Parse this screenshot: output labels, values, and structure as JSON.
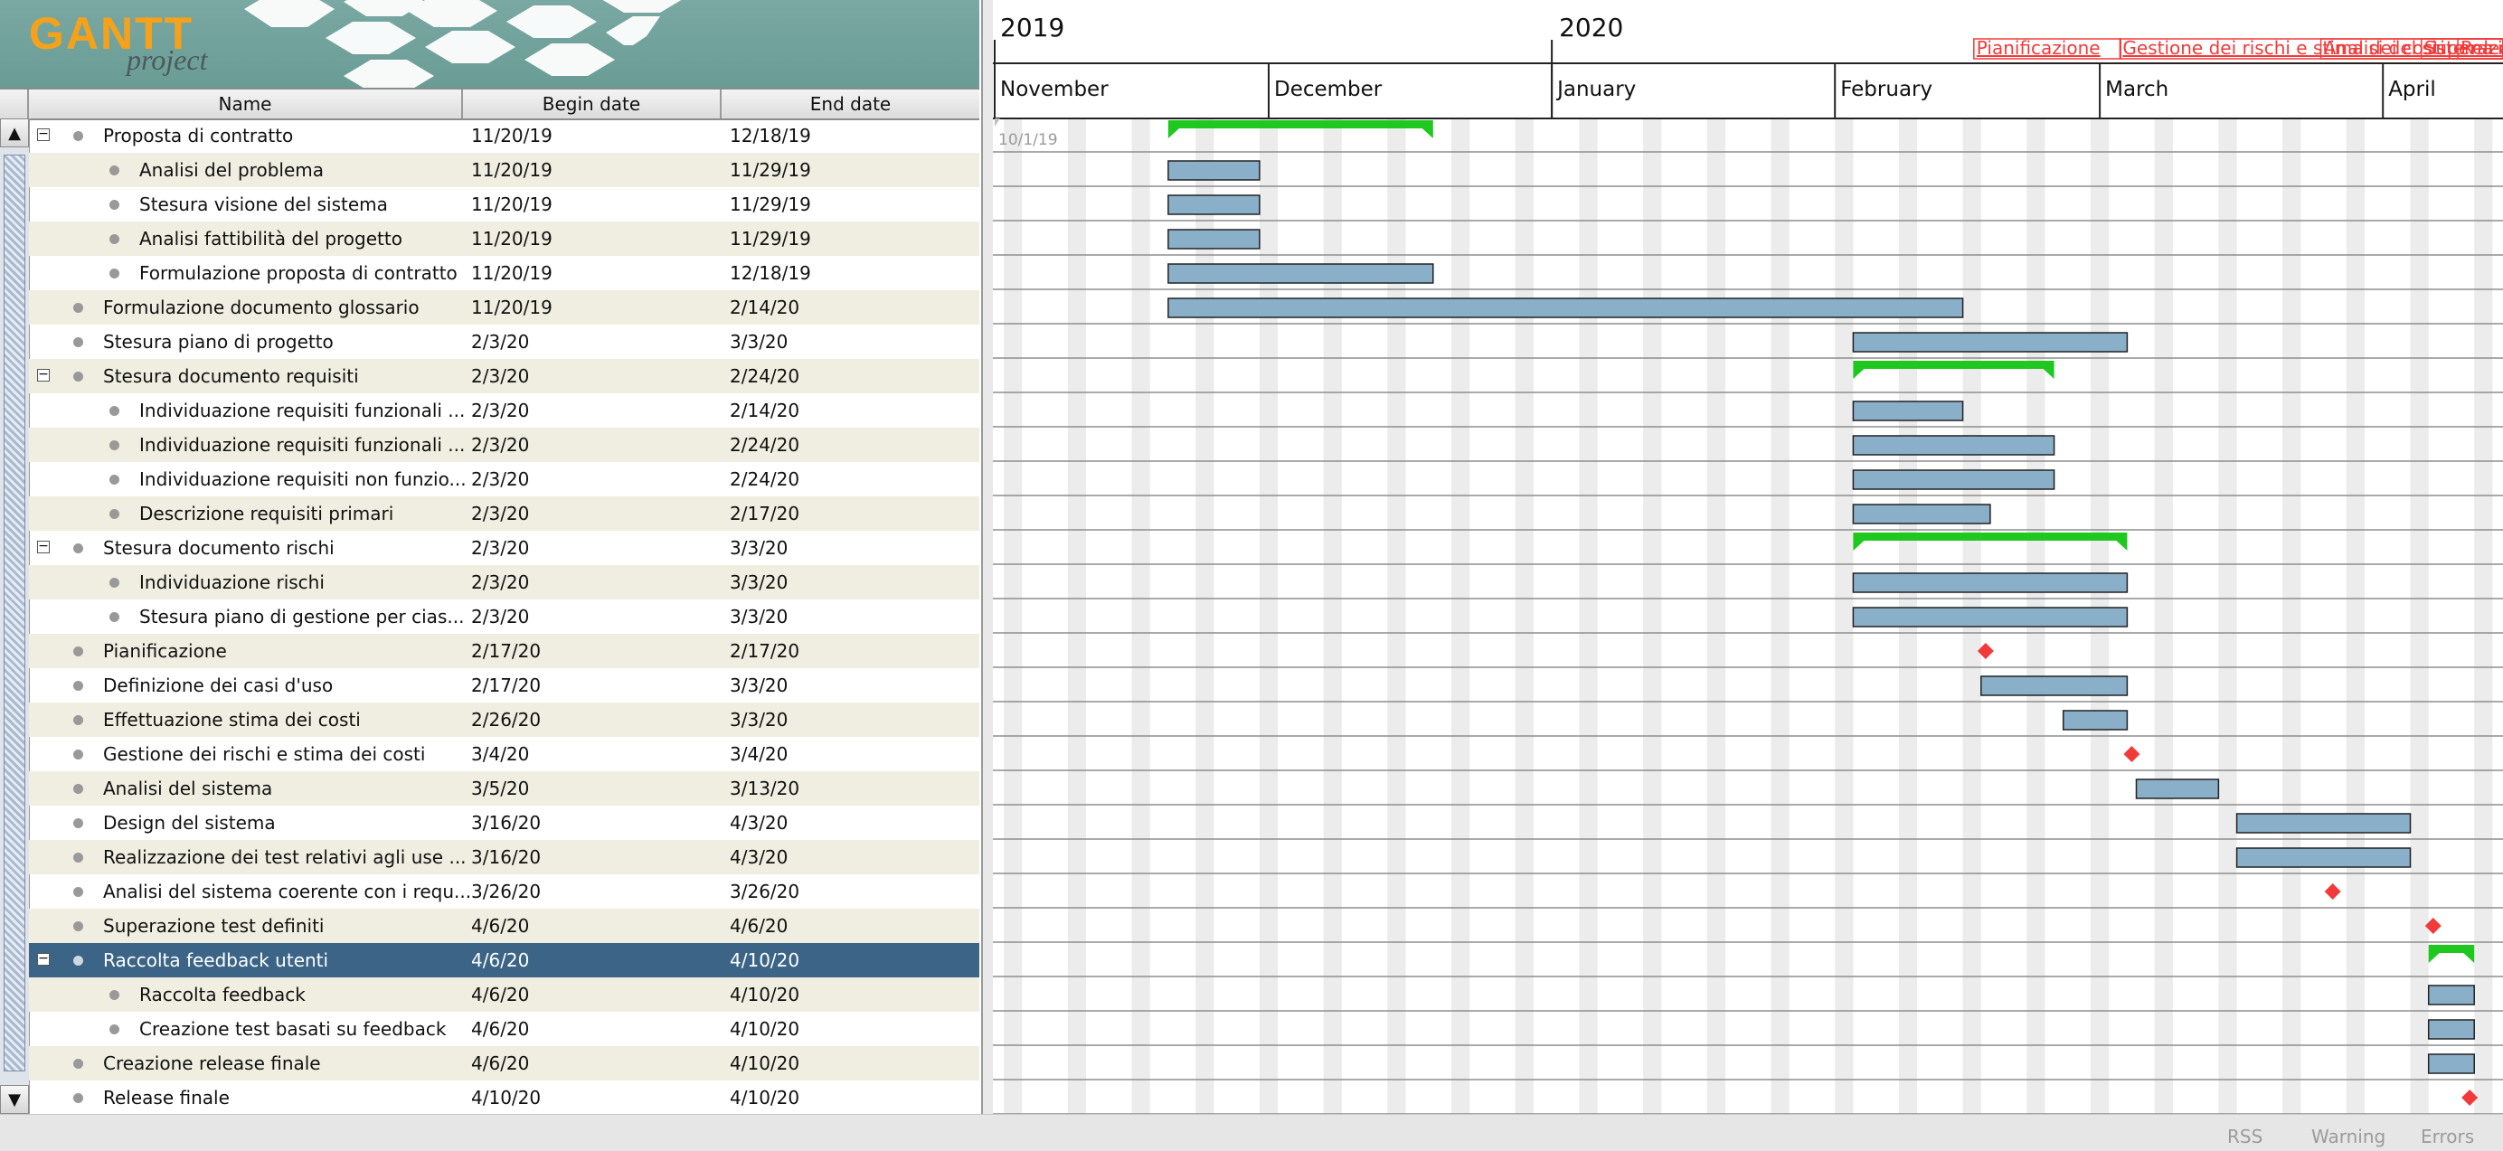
{
  "app": {
    "logo_text": "GANTT",
    "logo_sub": "project"
  },
  "table": {
    "columns": [
      "Name",
      "Begin date",
      "End date"
    ],
    "rows": [
      {
        "name": "Proposta di contratto",
        "begin": "11/20/19",
        "end": "12/18/19",
        "level": 0,
        "expander": "−",
        "selected": false
      },
      {
        "name": "Analisi del problema",
        "begin": "11/20/19",
        "end": "11/29/19",
        "level": 1,
        "expander": "",
        "selected": false
      },
      {
        "name": "Stesura visione del sistema",
        "begin": "11/20/19",
        "end": "11/29/19",
        "level": 1,
        "expander": "",
        "selected": false
      },
      {
        "name": "Analisi fattibilità del progetto",
        "begin": "11/20/19",
        "end": "11/29/19",
        "level": 1,
        "expander": "",
        "selected": false
      },
      {
        "name": "Formulazione proposta di contratto",
        "begin": "11/20/19",
        "end": "12/18/19",
        "level": 1,
        "expander": "",
        "selected": false
      },
      {
        "name": "Formulazione documento glossario",
        "begin": "11/20/19",
        "end": "2/14/20",
        "level": 0,
        "expander": "",
        "selected": false
      },
      {
        "name": "Stesura piano di progetto",
        "begin": "2/3/20",
        "end": "3/3/20",
        "level": 0,
        "expander": "",
        "selected": false
      },
      {
        "name": "Stesura documento requisiti",
        "begin": "2/3/20",
        "end": "2/24/20",
        "level": 0,
        "expander": "−",
        "selected": false
      },
      {
        "name": "Individuazione requisiti funzionali ...",
        "begin": "2/3/20",
        "end": "2/14/20",
        "level": 1,
        "expander": "",
        "selected": false
      },
      {
        "name": "Individuazione requisiti funzionali ...",
        "begin": "2/3/20",
        "end": "2/24/20",
        "level": 1,
        "expander": "",
        "selected": false
      },
      {
        "name": "Individuazione requisiti non funzio...",
        "begin": "2/3/20",
        "end": "2/24/20",
        "level": 1,
        "expander": "",
        "selected": false
      },
      {
        "name": "Descrizione requisiti primari",
        "begin": "2/3/20",
        "end": "2/17/20",
        "level": 1,
        "expander": "",
        "selected": false
      },
      {
        "name": "Stesura documento rischi",
        "begin": "2/3/20",
        "end": "3/3/20",
        "level": 0,
        "expander": "−",
        "selected": false
      },
      {
        "name": "Individuazione rischi",
        "begin": "2/3/20",
        "end": "3/3/20",
        "level": 1,
        "expander": "",
        "selected": false
      },
      {
        "name": "Stesura piano di gestione per cias...",
        "begin": "2/3/20",
        "end": "3/3/20",
        "level": 1,
        "expander": "",
        "selected": false
      },
      {
        "name": "Pianificazione",
        "begin": "2/17/20",
        "end": "2/17/20",
        "level": 0,
        "expander": "",
        "selected": false
      },
      {
        "name": "Definizione dei casi d'uso",
        "begin": "2/17/20",
        "end": "3/3/20",
        "level": 0,
        "expander": "",
        "selected": false
      },
      {
        "name": "Effettuazione stima dei costi",
        "begin": "2/26/20",
        "end": "3/3/20",
        "level": 0,
        "expander": "",
        "selected": false
      },
      {
        "name": "Gestione dei rischi e stima dei costi",
        "begin": "3/4/20",
        "end": "3/4/20",
        "level": 0,
        "expander": "",
        "selected": false
      },
      {
        "name": "Analisi del sistema",
        "begin": "3/5/20",
        "end": "3/13/20",
        "level": 0,
        "expander": "",
        "selected": false
      },
      {
        "name": "Design del sistema",
        "begin": "3/16/20",
        "end": "4/3/20",
        "level": 0,
        "expander": "",
        "selected": false
      },
      {
        "name": "Realizzazione dei test relativi agli use ...",
        "begin": "3/16/20",
        "end": "4/3/20",
        "level": 0,
        "expander": "",
        "selected": false
      },
      {
        "name": "Analisi del sistema coerente con i requ...",
        "begin": "3/26/20",
        "end": "3/26/20",
        "level": 0,
        "expander": "",
        "selected": false
      },
      {
        "name": "Superazione test definiti",
        "begin": "4/6/20",
        "end": "4/6/20",
        "level": 0,
        "expander": "",
        "selected": false
      },
      {
        "name": "Raccolta feedback utenti",
        "begin": "4/6/20",
        "end": "4/10/20",
        "level": 0,
        "expander": "−",
        "selected": true
      },
      {
        "name": "Raccolta feedback",
        "begin": "4/6/20",
        "end": "4/10/20",
        "level": 1,
        "expander": "",
        "selected": false
      },
      {
        "name": "Creazione test basati su feedback",
        "begin": "4/6/20",
        "end": "4/10/20",
        "level": 1,
        "expander": "",
        "selected": false
      },
      {
        "name": "Creazione release finale",
        "begin": "4/6/20",
        "end": "4/10/20",
        "level": 0,
        "expander": "",
        "selected": false
      },
      {
        "name": "Release finale",
        "begin": "4/10/20",
        "end": "4/10/20",
        "level": 0,
        "expander": "",
        "selected": false
      }
    ]
  },
  "timeline": {
    "years": [
      "2019",
      "2020"
    ],
    "months": [
      "November",
      "December",
      "January",
      "February",
      "March",
      "April"
    ],
    "view_start_label": "10/1/19",
    "milestone_labels": [
      "Pianificazione",
      "Gestione dei rischi e stima dei costi",
      "Analisi del sistema coerente con i requ...",
      "Superazione test definiti",
      "Release finale"
    ]
  },
  "tasks": [
    {
      "type": "summary",
      "start": "2019-11-20",
      "end": "2019-12-18"
    },
    {
      "type": "task",
      "start": "2019-11-20",
      "end": "2019-11-29"
    },
    {
      "type": "task",
      "start": "2019-11-20",
      "end": "2019-11-29"
    },
    {
      "type": "task",
      "start": "2019-11-20",
      "end": "2019-11-29"
    },
    {
      "type": "task",
      "start": "2019-11-20",
      "end": "2019-12-18"
    },
    {
      "type": "task",
      "start": "2019-11-20",
      "end": "2020-02-14"
    },
    {
      "type": "task",
      "start": "2020-02-03",
      "end": "2020-03-03"
    },
    {
      "type": "summary",
      "start": "2020-02-03",
      "end": "2020-02-24"
    },
    {
      "type": "task",
      "start": "2020-02-03",
      "end": "2020-02-14"
    },
    {
      "type": "task",
      "start": "2020-02-03",
      "end": "2020-02-24"
    },
    {
      "type": "task",
      "start": "2020-02-03",
      "end": "2020-02-24"
    },
    {
      "type": "task",
      "start": "2020-02-03",
      "end": "2020-02-17"
    },
    {
      "type": "summary",
      "start": "2020-02-03",
      "end": "2020-03-03"
    },
    {
      "type": "task",
      "start": "2020-02-03",
      "end": "2020-03-03"
    },
    {
      "type": "task",
      "start": "2020-02-03",
      "end": "2020-03-03"
    },
    {
      "type": "milestone",
      "start": "2020-02-17",
      "end": "2020-02-17"
    },
    {
      "type": "task",
      "start": "2020-02-17",
      "end": "2020-03-03"
    },
    {
      "type": "task",
      "start": "2020-02-26",
      "end": "2020-03-03"
    },
    {
      "type": "milestone",
      "start": "2020-03-04",
      "end": "2020-03-04"
    },
    {
      "type": "task",
      "start": "2020-03-05",
      "end": "2020-03-13"
    },
    {
      "type": "task",
      "start": "2020-03-16",
      "end": "2020-04-03"
    },
    {
      "type": "task",
      "start": "2020-03-16",
      "end": "2020-04-03"
    },
    {
      "type": "milestone",
      "start": "2020-03-26",
      "end": "2020-03-26"
    },
    {
      "type": "milestone",
      "start": "2020-04-06",
      "end": "2020-04-06"
    },
    {
      "type": "summary",
      "start": "2020-04-06",
      "end": "2020-04-10"
    },
    {
      "type": "task",
      "start": "2020-04-06",
      "end": "2020-04-10"
    },
    {
      "type": "task",
      "start": "2020-04-06",
      "end": "2020-04-10"
    },
    {
      "type": "task",
      "start": "2020-04-06",
      "end": "2020-04-10"
    },
    {
      "type": "milestone",
      "start": "2020-04-10",
      "end": "2020-04-10"
    }
  ],
  "colors": {
    "task_bar": "#8aafc9",
    "summary_bar": "#1ec81e",
    "milestone": "#f23a3a",
    "selected_row": "#3b6486",
    "alt_row": "#efeee0",
    "weekend": "#ececec"
  },
  "status_bar": [
    "RSS",
    "Warning",
    "Errors"
  ]
}
